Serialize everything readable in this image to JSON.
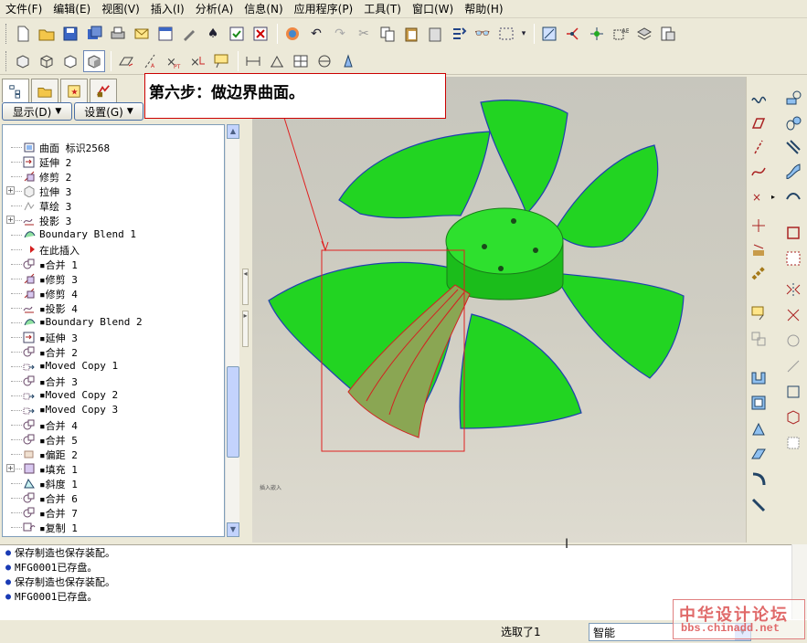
{
  "menubar": {
    "items": [
      "文件(F)",
      "编辑(E)",
      "视图(V)",
      "插入(I)",
      "分析(A)",
      "信息(N)",
      "应用程序(P)",
      "工具(T)",
      "窗口(W)",
      "帮助(H)"
    ]
  },
  "callout": {
    "text": "第六步：做边界曲面。"
  },
  "left_panel": {
    "show_button": "显示(D)",
    "settings_button": "设置(G)"
  },
  "tree": {
    "items": [
      {
        "label": "曲面 标识2568",
        "icon": "surface-icon",
        "expand": ""
      },
      {
        "label": "延伸 2",
        "icon": "extend-icon",
        "expand": ""
      },
      {
        "label": "修剪 2",
        "icon": "trim-icon",
        "expand": ""
      },
      {
        "label": "拉伸 3",
        "icon": "extrude-icon",
        "expand": "+"
      },
      {
        "label": "草绘 3",
        "icon": "sketch-icon",
        "expand": ""
      },
      {
        "label": "投影 3",
        "icon": "project-icon",
        "expand": "+"
      },
      {
        "label": "Boundary Blend 1",
        "icon": "boundary-blend-icon",
        "expand": ""
      },
      {
        "label": "在此插入",
        "icon": "insert-here-arrow-icon",
        "expand": ""
      },
      {
        "label": "▪合并 1",
        "icon": "merge-icon",
        "expand": ""
      },
      {
        "label": "▪修剪 3",
        "icon": "trim-icon",
        "expand": ""
      },
      {
        "label": "▪修剪 4",
        "icon": "trim-icon",
        "expand": ""
      },
      {
        "label": "▪投影 4",
        "icon": "project-icon",
        "expand": ""
      },
      {
        "label": "▪Boundary Blend 2",
        "icon": "boundary-blend-icon",
        "expand": ""
      },
      {
        "label": "▪延伸 3",
        "icon": "extend-icon",
        "expand": ""
      },
      {
        "label": "▪合并 2",
        "icon": "merge-icon",
        "expand": ""
      },
      {
        "label": "▪Moved Copy 1",
        "icon": "moved-copy-icon",
        "expand": ""
      },
      {
        "label": "▪合并 3",
        "icon": "merge-icon",
        "expand": ""
      },
      {
        "label": "▪Moved Copy 2",
        "icon": "moved-copy-icon",
        "expand": ""
      },
      {
        "label": "▪Moved Copy 3",
        "icon": "moved-copy-icon",
        "expand": ""
      },
      {
        "label": "▪合并 4",
        "icon": "merge-icon",
        "expand": ""
      },
      {
        "label": "▪合并 5",
        "icon": "merge-icon",
        "expand": ""
      },
      {
        "label": "▪偏距 2",
        "icon": "offset-icon",
        "expand": ""
      },
      {
        "label": "▪填充 1",
        "icon": "fill-icon",
        "expand": "+"
      },
      {
        "label": "▪斜度 1",
        "icon": "draft-icon",
        "expand": ""
      },
      {
        "label": "▪合并 6",
        "icon": "merge-icon",
        "expand": ""
      },
      {
        "label": "▪合并 7",
        "icon": "merge-icon",
        "expand": ""
      },
      {
        "label": "▪复制 1",
        "icon": "copy-icon",
        "expand": ""
      }
    ]
  },
  "viewport": {
    "label": "插入嵌入"
  },
  "messages": [
    "保存制造也保存装配。",
    "MFG0001已存盘。",
    "保存制造也保存装配。",
    "MFG0001已存盘。"
  ],
  "status": {
    "selected": "选取了1",
    "filter": "智能"
  },
  "watermark": {
    "line1": "中华设计论坛",
    "line2": "bbs.chinadd.net"
  },
  "colors": {
    "fan_green": "#1fce1f",
    "highlight_red": "#e02020",
    "message_bullet": "#1a3bb5"
  }
}
